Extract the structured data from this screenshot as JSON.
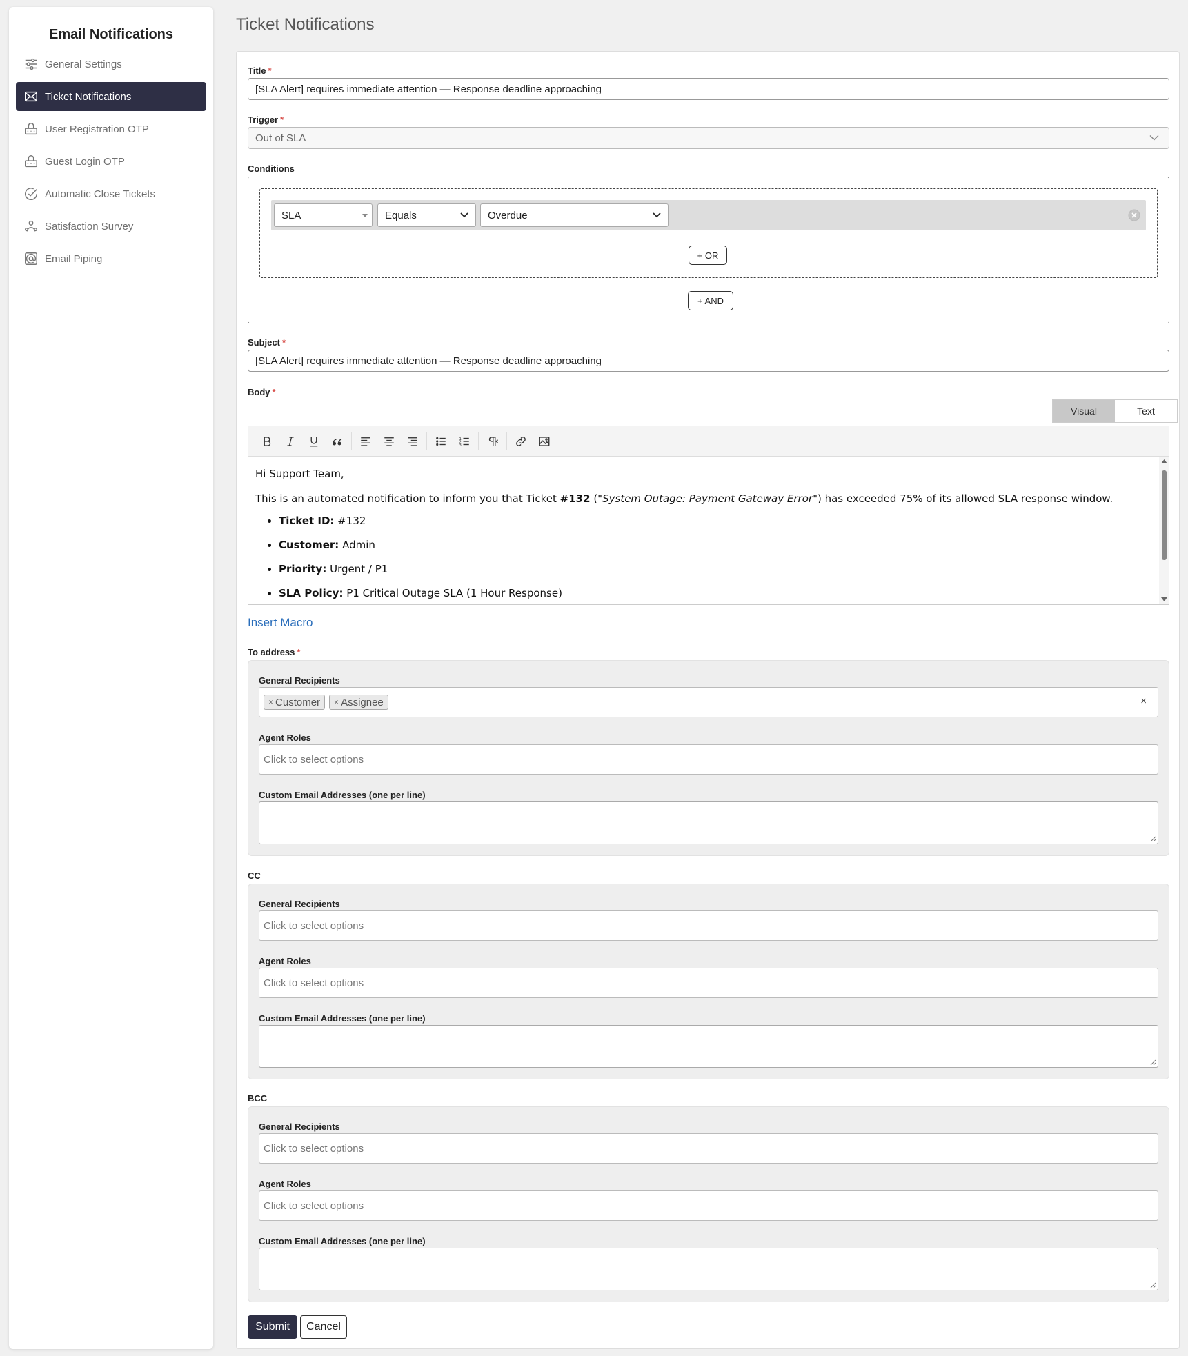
{
  "sidebar": {
    "title": "Email Notifications",
    "items": [
      {
        "label": "General Settings",
        "icon": "sliders-icon"
      },
      {
        "label": "Ticket Notifications",
        "icon": "envelope-icon",
        "active": true
      },
      {
        "label": "User Registration OTP",
        "icon": "otp-icon"
      },
      {
        "label": "Guest Login OTP",
        "icon": "otp-icon"
      },
      {
        "label": "Automatic Close Tickets",
        "icon": "check-circle-icon"
      },
      {
        "label": "Satisfaction Survey",
        "icon": "users-icon"
      },
      {
        "label": "Email Piping",
        "icon": "at-sign-icon"
      }
    ]
  },
  "page": {
    "title": "Ticket Notifications"
  },
  "form": {
    "title_label": "Title",
    "title_value": "[SLA Alert] requires immediate attention — Response deadline approaching",
    "trigger_label": "Trigger",
    "trigger_value": "Out of SLA",
    "conditions_label": "Conditions",
    "condition": {
      "field": "SLA",
      "operator": "Equals",
      "value": "Overdue"
    },
    "or_button": "+ OR",
    "and_button": "+ AND",
    "subject_label": "Subject",
    "subject_value": "[SLA Alert] requires immediate attention — Response deadline approaching",
    "body_label": "Body",
    "editor_tabs": {
      "visual": "Visual",
      "text": "Text"
    },
    "body": {
      "greeting": "Hi Support Team,",
      "intro_pre": "This is an automated notification to inform you that Ticket ",
      "intro_ticket": "#132",
      "intro_mid_open": " (\"",
      "intro_title": "System Outage: Payment Gateway Error",
      "intro_post": "\") has exceeded 75% of its allowed SLA response window.",
      "items": [
        {
          "key": "Ticket ID:",
          "value": " #132"
        },
        {
          "key": "Customer:",
          "value": " Admin"
        },
        {
          "key": "Priority:",
          "value": " Urgent / P1"
        },
        {
          "key": "SLA Policy:",
          "value": " P1 Critical Outage SLA (1 Hour Response)"
        }
      ]
    },
    "insert_macro": "Insert Macro",
    "to_label": "To address",
    "cc_label": "CC",
    "bcc_label": "BCC",
    "general_recipients_label": "General Recipients",
    "agent_roles_label": "Agent Roles",
    "custom_emails_label": "Custom Email Addresses (one per line)",
    "placeholder": "Click to select options",
    "to_chips": [
      "Customer",
      "Assignee"
    ],
    "chip_remove": "×",
    "clear_all": "×",
    "submit": "Submit",
    "cancel": "Cancel"
  },
  "colors": {
    "accent": "#2e2f45",
    "required": "#d9534f",
    "link": "#2a6ebb"
  }
}
